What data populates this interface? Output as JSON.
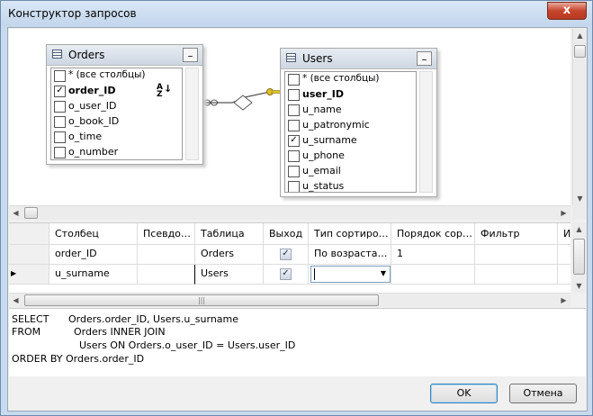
{
  "window": {
    "title": "Конструктор запросов",
    "close_glyph": "x"
  },
  "tables": [
    {
      "title": "Orders",
      "minimize_glyph": "_",
      "columns": [
        {
          "label": "* (все столбцы)",
          "checked": false,
          "bold": false
        },
        {
          "label": "order_ID",
          "checked": true,
          "bold": true,
          "sort_icon": "az-sort-icon"
        },
        {
          "label": "o_user_ID",
          "checked": false,
          "bold": false
        },
        {
          "label": "o_book_ID",
          "checked": false,
          "bold": false
        },
        {
          "label": "o_time",
          "checked": false,
          "bold": false
        },
        {
          "label": "o_number",
          "checked": false,
          "bold": false
        }
      ]
    },
    {
      "title": "Users",
      "minimize_glyph": "_",
      "columns": [
        {
          "label": "* (все столбцы)",
          "checked": false,
          "bold": false
        },
        {
          "label": "user_ID",
          "checked": false,
          "bold": true
        },
        {
          "label": "u_name",
          "checked": false,
          "bold": false
        },
        {
          "label": "u_patronymic",
          "checked": false,
          "bold": false
        },
        {
          "label": "u_surname",
          "checked": true,
          "bold": false
        },
        {
          "label": "u_phone",
          "checked": false,
          "bold": false
        },
        {
          "label": "u_email",
          "checked": false,
          "bold": false
        },
        {
          "label": "u_status",
          "checked": false,
          "bold": false
        }
      ]
    }
  ],
  "grid": {
    "headers": [
      "Столбец",
      "Псевдо…",
      "Таблица",
      "Выход",
      "Тип сортиро…",
      "Порядок сор…",
      "Фильтр",
      "И"
    ],
    "rows": [
      {
        "column": "order_ID",
        "alias": "",
        "table": "Orders",
        "output": true,
        "sort_type": "По возраста…",
        "sort_order": "1",
        "filter": ""
      },
      {
        "column": "u_surname",
        "alias": "",
        "table": "Users",
        "output": true,
        "sort_type": "",
        "sort_order": "",
        "filter": ""
      }
    ],
    "current_row_pointer": "▶",
    "hscroll_thumb_glyph": "|||"
  },
  "sql": {
    "line1_kw": "SELECT",
    "line1_val": "Orders.order_ID, Users.u_surname",
    "line2_kw": "FROM",
    "line2_val": "Orders INNER JOIN",
    "line3_val": "Users ON Orders.o_user_ID = Users.user_ID",
    "line4": "ORDER BY Orders.order_ID"
  },
  "buttons": {
    "ok": "OK",
    "cancel": "Отмена"
  },
  "colors": {
    "title_bar": "#c8daee",
    "close_button": "#c6442c",
    "diagram_bg": "#ffffff",
    "ok_border": "#3c7fb1"
  }
}
